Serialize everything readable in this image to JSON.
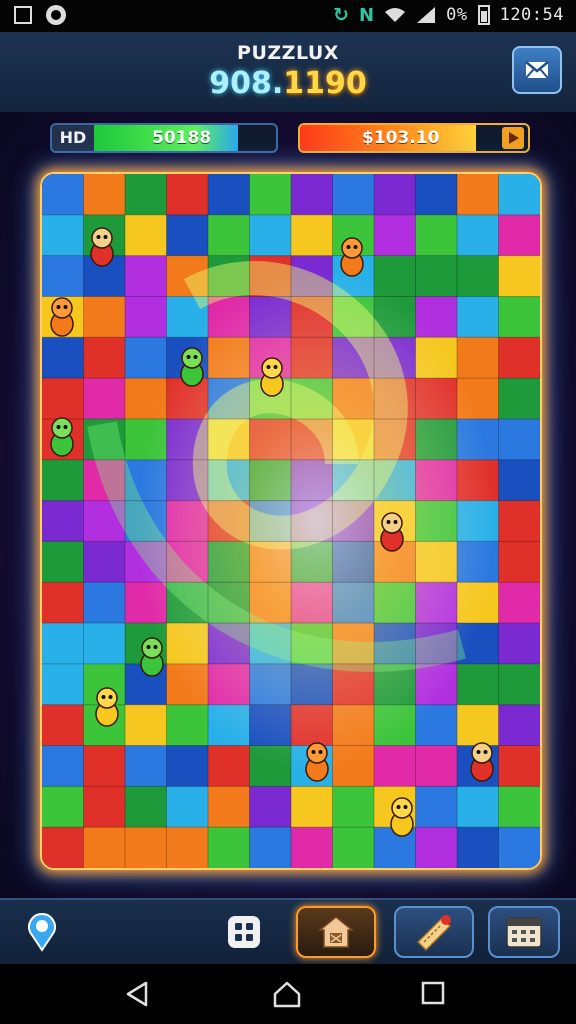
{
  "status_bar": {
    "battery_text": "0%",
    "time": "120:54"
  },
  "header": {
    "title": "PUZZLUX",
    "score_part1": "908.",
    "score_part2": "1190"
  },
  "meters": {
    "left": {
      "tag": "HD",
      "value": "50188",
      "fill_fraction": 0.78,
      "colors": [
        "#1ec83a",
        "#2aa8f0"
      ]
    },
    "right": {
      "value": "$103.10",
      "fill_fraction": 0.88,
      "colors": [
        "#ff3a1a",
        "#ffd23a"
      ]
    }
  },
  "board": {
    "columns": 12,
    "rows": 17,
    "palette": [
      "#e0302a",
      "#f37a1a",
      "#f5c71f",
      "#3cc43a",
      "#1f9a3a",
      "#2a78e0",
      "#1a4fc0",
      "#7a2ad0",
      "#b22fe0",
      "#e02aa8",
      "#2ab0e8"
    ],
    "characters": [
      "fox",
      "bird",
      "frog",
      "monster",
      "cat",
      "pig",
      "blob",
      "knight"
    ]
  },
  "bottom_nav": {
    "items": [
      "map-pin",
      "grid",
      "home",
      "ticket",
      "calendar"
    ],
    "active": "home"
  },
  "system_nav": [
    "back",
    "home",
    "recents"
  ]
}
